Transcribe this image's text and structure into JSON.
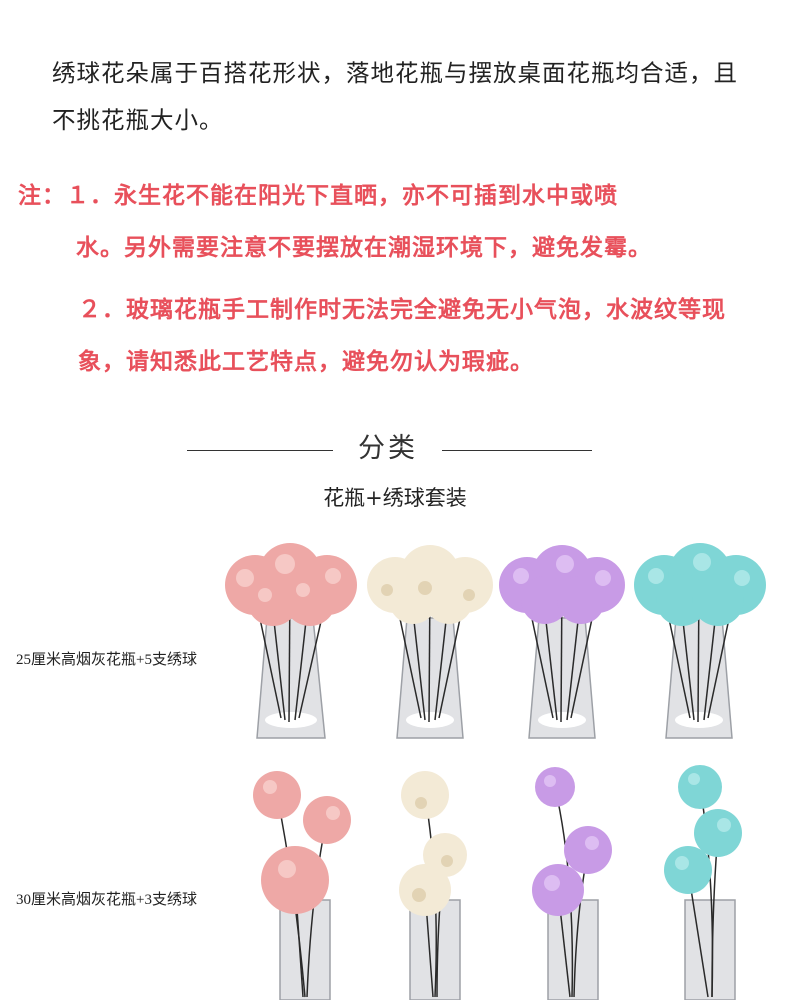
{
  "intro": {
    "text": "绣球花朵属于百搭花形状，落地花瓶与摆放桌面花瓶均合适，且不挑花瓶大小。"
  },
  "notes": {
    "note1_line1": "注：１．永生花不能在阳光下直晒，亦不可插到水中或喷",
    "note1_line2": "水。另外需要注意不要摆放在潮湿环境下，避免发霉。",
    "note2": "２．玻璃花瓶手工制作时无法完全避免无小气泡，水波纹等现象，请知悉此工艺特点，避免勿认为瑕疵。"
  },
  "section": {
    "title": "分类",
    "subtitle": "花瓶+绣球套装"
  },
  "rows": [
    {
      "label": "25厘米高烟灰花瓶+5支绣球"
    },
    {
      "label": "30厘米高烟灰花瓶+3支绣球"
    }
  ],
  "colors": {
    "text": "#222222",
    "note": "#e8505b",
    "flower_pink": "#eea8a6",
    "flower_cream": "#f3ead6",
    "flower_purple": "#c89be6",
    "flower_teal": "#7fd6d6",
    "vase_glass": "#c9cbcf"
  },
  "products": [
    {
      "row": 1,
      "flower_color": "pink"
    },
    {
      "row": 1,
      "flower_color": "cream"
    },
    {
      "row": 1,
      "flower_color": "purple"
    },
    {
      "row": 1,
      "flower_color": "teal"
    },
    {
      "row": 2,
      "flower_color": "pink"
    },
    {
      "row": 2,
      "flower_color": "cream"
    },
    {
      "row": 2,
      "flower_color": "purple"
    },
    {
      "row": 2,
      "flower_color": "teal"
    }
  ]
}
